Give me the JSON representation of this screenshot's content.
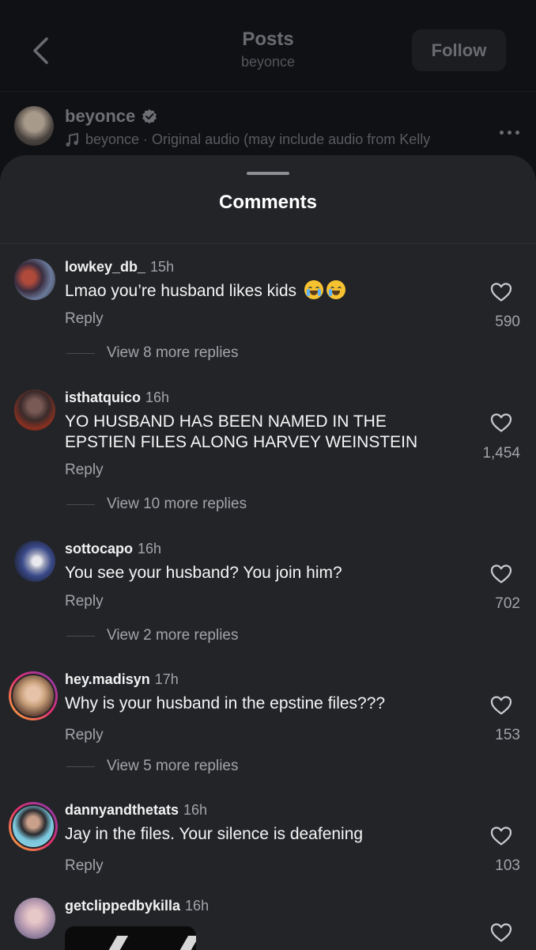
{
  "header": {
    "title": "Posts",
    "subtitle": "beyonce",
    "follow_label": "Follow"
  },
  "post": {
    "username": "beyonce",
    "audio": "beyonce · Original audio  (may include audio from Kelly"
  },
  "sheet": {
    "title": "Comments"
  },
  "comments": [
    {
      "user": "lowkey_db_",
      "time": "15h",
      "text": "Lmao you’re husband likes kids",
      "emojis": [
        "loudly-crying-face",
        "face-with-tears-of-joy"
      ],
      "reply": "Reply",
      "likes": "590",
      "view_replies": "View 8 more replies"
    },
    {
      "user": "isthatquico",
      "time": "16h",
      "text": "YO HUSBAND HAS BEEN NAMED IN THE EPSTIEN FILES ALONG HARVEY WEINSTEIN",
      "reply": "Reply",
      "likes": "1,454",
      "view_replies": "View 10 more replies"
    },
    {
      "user": "sottocapo",
      "time": "16h",
      "text": "You see your husband? You join him?",
      "reply": "Reply",
      "likes": "702",
      "view_replies": "View 2 more replies"
    },
    {
      "user": "hey.madisyn",
      "time": "17h",
      "text": "Why is your husband in the epstine files???",
      "reply": "Reply",
      "likes": "153",
      "view_replies": "View 5 more replies"
    },
    {
      "user": "dannyandthetats",
      "time": "16h",
      "text": "Jay in the files. Your silence is deafening",
      "reply": "Reply",
      "likes": "103"
    },
    {
      "user": "getclippedbykilla",
      "time": "16h"
    }
  ],
  "colors": {
    "sheet_bg": "#232428",
    "page_bg": "#101114",
    "text_primary": "#f5f5f5",
    "text_secondary": "#a3a4a9"
  }
}
